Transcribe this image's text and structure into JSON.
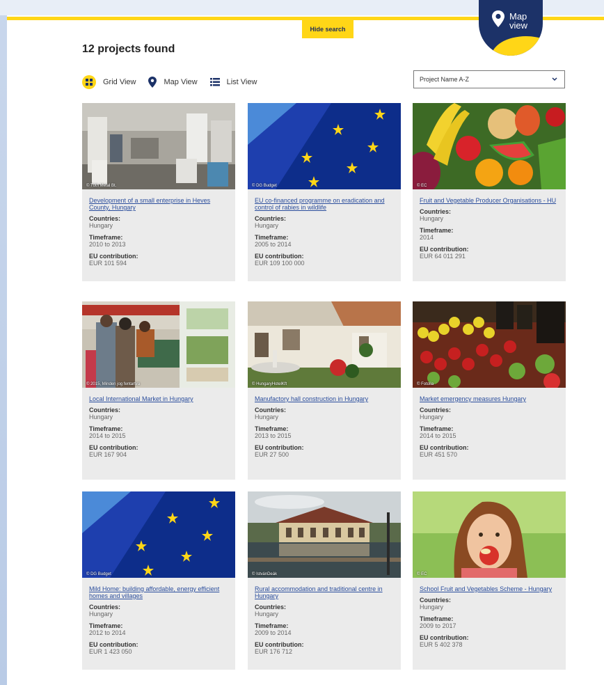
{
  "header": {
    "hide_search": "Hide search",
    "map_view": [
      "Map",
      "view"
    ]
  },
  "results": {
    "count_text": "12 projects found"
  },
  "views": {
    "grid": "Grid View",
    "map": "Map View",
    "list": "List View"
  },
  "sort": {
    "selected": "Project Name A-Z"
  },
  "labels": {
    "countries": "Countries:",
    "timeframe": "Timeframe:",
    "contribution": "EU contribution:"
  },
  "colors": {
    "accent_yellow": "#ffd617",
    "navy": "#1c3268",
    "link": "#2a4d9c"
  },
  "cards": [
    {
      "title": "Development of a small enterprise in Heves County, Hungary",
      "credit": "© Tóth Metal Bt.",
      "countries": "Hungary",
      "timeframe": "2010 to 2013",
      "contribution": "EUR 101 594"
    },
    {
      "title": "EU co-financed programme on eradication and control of rabies in wildlife",
      "credit": "© DG Budget",
      "countries": "Hungary",
      "timeframe": "2005 to 2014",
      "contribution": "EUR 109 100 000"
    },
    {
      "title": "Fruit and Vegetable Producer Organisations - HU",
      "credit": "© EC",
      "countries": "Hungary",
      "timeframe": "2014",
      "contribution": "EUR 64 011 291"
    },
    {
      "title": "Local International Market in Hungary",
      "credit": "© 2015, Minden jog fentartva",
      "countries": "Hungary",
      "timeframe": "2014 to 2015",
      "contribution": "EUR 167 904"
    },
    {
      "title": "Manufactory hall construction in Hungary",
      "credit": "© HungaryHotelKft",
      "countries": "Hungary",
      "timeframe": "2013 to 2015",
      "contribution": "EUR 27 500"
    },
    {
      "title": "Market emergency measures Hungary",
      "credit": "© Fotolia",
      "countries": "Hungary",
      "timeframe": "2014 to 2015",
      "contribution": "EUR 451 570"
    },
    {
      "title": "Mild Home: building affordable, energy efficient homes and villages",
      "credit": "© DG Budget",
      "countries": "Hungary",
      "timeframe": "2012 to 2014",
      "contribution": "EUR 1 423 050"
    },
    {
      "title": "Rural accommodation and traditional centre in Hungary",
      "credit": "© IstvánDeák",
      "countries": "Hungary",
      "timeframe": "2009 to 2014",
      "contribution": "EUR 176 712"
    },
    {
      "title": "School Fruit and Vegetables Scheme - Hungary",
      "credit": "© EC",
      "countries": "Hungary",
      "timeframe": "2009 to 2017",
      "contribution": "EUR 5 402 378"
    }
  ]
}
